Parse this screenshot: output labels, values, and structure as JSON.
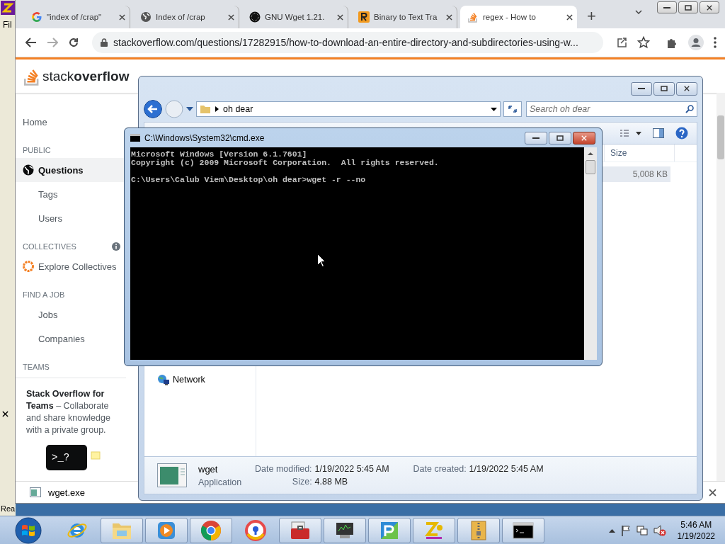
{
  "side_app": {
    "menu_text": "Fil",
    "status_text": "Rea"
  },
  "browser": {
    "tabs": [
      {
        "title": "\"index of /crap\"",
        "kind": "google",
        "selected": false
      },
      {
        "title": "Index of /crap",
        "kind": "globe",
        "selected": false
      },
      {
        "title": "GNU Wget 1.21.",
        "kind": "gnu",
        "selected": false
      },
      {
        "title": "Binary to Text Tra",
        "kind": "r",
        "selected": false
      },
      {
        "title": "regex - How to",
        "kind": "stack",
        "selected": true
      }
    ],
    "new_tab": "+",
    "url": "stackoverflow.com/questions/17282915/how-to-download-an-entire-directory-and-subdirectories-using-w..."
  },
  "site": {
    "logo": {
      "light": "stack",
      "bold": "overflow"
    },
    "sidebar": [
      {
        "kind": "link",
        "label": "Home",
        "selected": false
      },
      {
        "kind": "heading",
        "label": "PUBLIC"
      },
      {
        "kind": "globe_link",
        "label": "Questions",
        "selected": true
      },
      {
        "kind": "sublink",
        "label": "Tags",
        "selected": false
      },
      {
        "kind": "sublink",
        "label": "Users",
        "selected": false
      },
      {
        "kind": "heading",
        "label": "COLLECTIVES",
        "info": true
      },
      {
        "kind": "badge_link",
        "label": "Explore Collectives",
        "selected": false
      },
      {
        "kind": "heading",
        "label": "FIND A JOB"
      },
      {
        "kind": "sublink",
        "label": "Jobs",
        "selected": false
      },
      {
        "kind": "sublink",
        "label": "Companies",
        "selected": false
      },
      {
        "kind": "heading",
        "label": "TEAMS"
      }
    ],
    "teams_promo": "**Stack Overflow for Teams** – Collaborate and share knowledge with a private group.",
    "illustration_text": ">_?"
  },
  "downloads": [
    {
      "file": "wget.exe"
    }
  ],
  "explorer": {
    "path": "oh dear",
    "search": {
      "placeholder": "Search oh dear"
    },
    "columns": [
      "Size"
    ],
    "rows": [
      {
        "size": "5,008 KB",
        "selected": true
      }
    ],
    "nav": [
      {
        "label": "Network",
        "kind": "network"
      }
    ],
    "details": {
      "name": "wget",
      "type": "Application",
      "fields": [
        {
          "label": "Date modified:",
          "value": "1/19/2022 5:45 AM"
        },
        {
          "label": "Date created:",
          "value": "1/19/2022 5:45 AM"
        },
        {
          "label": "Size:",
          "value": "4.88 MB"
        }
      ]
    }
  },
  "cmd": {
    "title": "C:\\Windows\\System32\\cmd.exe",
    "output": [
      "Microsoft Windows [Version 6.1.7601]",
      "Copyright (c) 2009 Microsoft Corporation.  All rights reserved."
    ],
    "prompt": "C:\\Users\\Calub Viem\\Desktop\\oh dear>wget -r --no"
  },
  "taskbar": {
    "apps": [
      {
        "kind": "ie",
        "open": false
      },
      {
        "kind": "explorer",
        "open": true
      },
      {
        "kind": "media",
        "open": true
      },
      {
        "kind": "chrome",
        "open": true
      },
      {
        "kind": "vpn",
        "open": false
      },
      {
        "kind": "toolbox",
        "open": true
      },
      {
        "kind": "monitor",
        "open": true
      },
      {
        "kind": "app",
        "open": true
      },
      {
        "kind": "zip",
        "open": true
      },
      {
        "kind": "archive",
        "open": true
      },
      {
        "kind": "cmd",
        "open": true
      }
    ],
    "clock": {
      "time": "5:46 AM",
      "date": "1/19/2022"
    }
  }
}
